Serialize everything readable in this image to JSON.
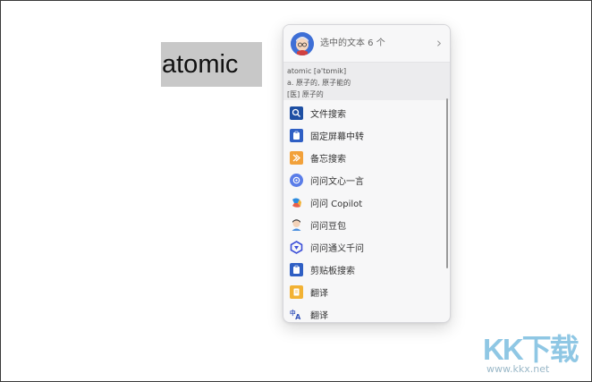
{
  "selected_word": "atomic",
  "popup": {
    "header_text": "选中的文本 6 个",
    "header_arrow": "›",
    "dict": {
      "word_line": "atomic [ə'tɒmik]",
      "meaning1": "a. 原子的, 原子能的",
      "meaning2": "[医] 原子的"
    },
    "items": [
      {
        "label": "文件搜索",
        "icon": "search-icon",
        "color": "#1e4fa3"
      },
      {
        "label": "固定屏幕中转",
        "icon": "pin-clipboard-icon",
        "color": "#2f5fc4"
      },
      {
        "label": "备忘搜索",
        "icon": "memo-icon",
        "color": "#f2a13a"
      },
      {
        "label": "问问文心一言",
        "icon": "wenxin-icon",
        "color": "#5a7de8"
      },
      {
        "label": "问问 Copilot",
        "icon": "copilot-icon",
        "color": "#e6603c"
      },
      {
        "label": "问问豆包",
        "icon": "doubao-icon",
        "color": "#4a8fe0"
      },
      {
        "label": "问问通义千问",
        "icon": "tongyi-icon",
        "color": "#3c4fd8"
      },
      {
        "label": "剪贴板搜索",
        "icon": "clipboard-icon",
        "color": "#2f5fc4"
      },
      {
        "label": "翻译",
        "icon": "translate-doc-icon",
        "color": "#f2b234"
      },
      {
        "label": "翻译",
        "icon": "translate-icon",
        "color": "#2f4fb8"
      }
    ]
  },
  "watermark": {
    "logo": "KK下载",
    "url": "www.kkx.net"
  }
}
